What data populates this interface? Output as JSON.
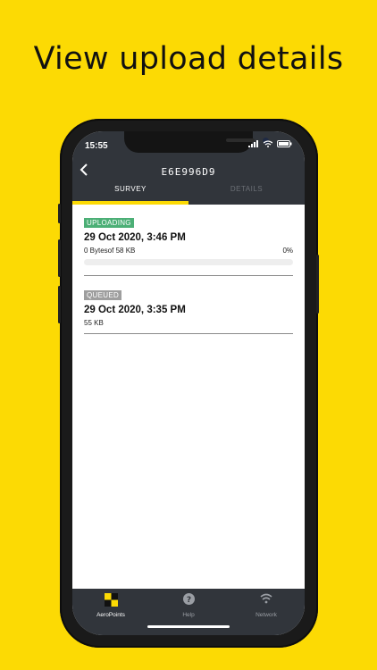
{
  "headline": "View upload details",
  "status_bar": {
    "time": "15:55"
  },
  "header": {
    "back_icon": "chevron-left-icon",
    "title": "E6E996D9"
  },
  "tabs": [
    {
      "label": "SURVEY",
      "active": true
    },
    {
      "label": "DETAILS",
      "active": false
    }
  ],
  "uploads": [
    {
      "status": "UPLOADING",
      "status_color": "#4caf76",
      "date": "29 Oct 2020, 3:46 PM",
      "size": "0 Bytesof 58 KB",
      "percent": "0%",
      "progress": 0
    },
    {
      "status": "QUEUED",
      "status_color": "#9e9e9e",
      "date": "29 Oct 2020, 3:35 PM",
      "size": "55 KB"
    }
  ],
  "bottom_nav": [
    {
      "label": "AeroPoints",
      "icon": "aeropoints-logo-icon",
      "active": true
    },
    {
      "label": "Help",
      "icon": "help-icon",
      "active": false
    },
    {
      "label": "Network",
      "icon": "wifi-icon",
      "active": false
    }
  ],
  "colors": {
    "background": "#FCDA04",
    "bar": "#31353b",
    "accent": "#FCDA04"
  }
}
